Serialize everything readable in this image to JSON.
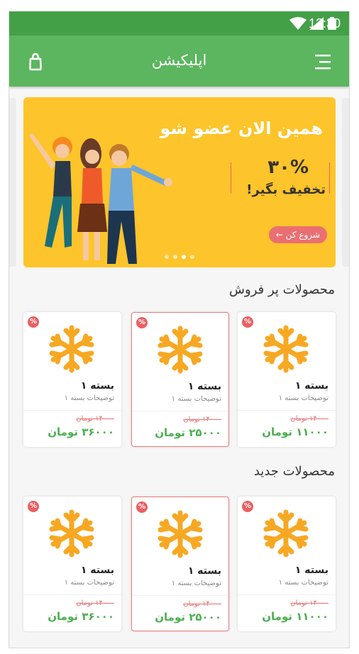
{
  "status_bar": {
    "time": "12:30"
  },
  "app_bar": {
    "title": "اپلیکیشن",
    "bag_icon": "shopping-bag-icon",
    "menu_icon": "hamburger-menu-icon"
  },
  "banner": {
    "headline": "همین الان عضو شو",
    "percent": "۳۰%",
    "offer": "تخفیف بگیر!",
    "cta": "شروع کن ←",
    "slide_count": 4,
    "active_slide": 2
  },
  "sections": [
    {
      "title": "محصولات پر فروش",
      "products": [
        {
          "name": "بسته ۱",
          "desc": "توضیحات بسته ۱",
          "old_price": "۱۴۰۰۰ تومان",
          "price": "۱۱۰۰۰ تومان",
          "badge": "%"
        },
        {
          "name": "بسته ۱",
          "desc": "توضیحات بسته ۱",
          "old_price": "۱۴۰۰۰ تومان",
          "price": "۲۵۰۰۰ تومان",
          "badge": "%"
        },
        {
          "name": "بسته ۱",
          "desc": "توضیحات بسته ۱",
          "old_price": "۱۴۰۰۰ تومان",
          "price": "۳۶۰۰۰ تومان",
          "badge": "%"
        }
      ]
    },
    {
      "title": "محصولات جدید",
      "products": [
        {
          "name": "بسته ۱",
          "desc": "توضیحات بسته ۱",
          "old_price": "۱۴۰۰۰ تومان",
          "price": "۱۱۰۰۰ تومان",
          "badge": "%"
        },
        {
          "name": "بسته ۱",
          "desc": "توضیحات بسته ۱",
          "old_price": "۱۴۰۰۰ تومان",
          "price": "۲۵۰۰۰ تومان",
          "badge": "%"
        },
        {
          "name": "بسته ۱",
          "desc": "توضیحات بسته ۱",
          "old_price": "۱۴۰۰۰ تومان",
          "price": "۳۶۰۰۰ تومان",
          "badge": "%"
        }
      ]
    }
  ],
  "colors": {
    "primary": "#5cb55f",
    "status": "#43a047",
    "banner": "#fdc42b",
    "accent": "#ec5f61",
    "price": "#4caf50",
    "flake": "#f7a823"
  }
}
